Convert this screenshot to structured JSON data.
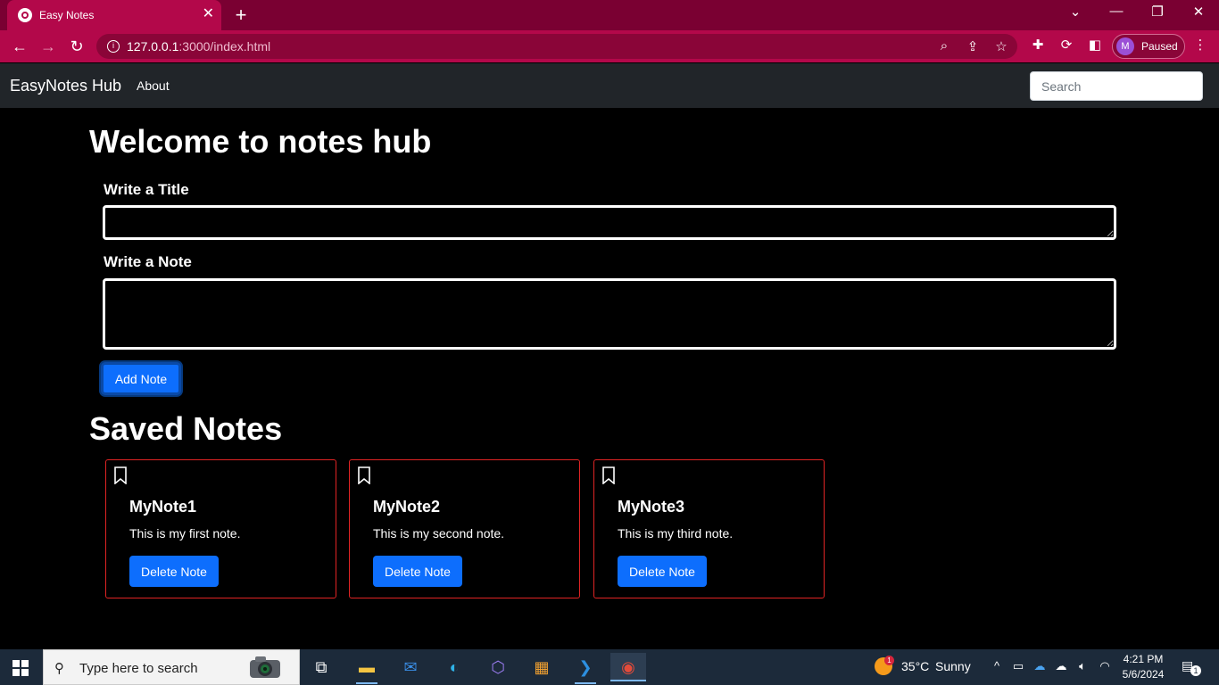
{
  "browser": {
    "tab_title": "Easy Notes",
    "tab_close": "✕",
    "new_tab": "+",
    "url_host": "127.0.0.1",
    "url_path": ":3000/index.html",
    "profile_initial": "M",
    "profile_status": "Paused",
    "window_controls": {
      "dropdown": "⌄",
      "minimize": "—",
      "restore": "❐",
      "close": "✕"
    }
  },
  "navbar": {
    "brand": "EasyNotes Hub",
    "links": [
      {
        "label": "About"
      }
    ],
    "search_placeholder": "Search"
  },
  "main": {
    "heading": "Welcome to notes hub",
    "title_label": "Write a Title",
    "note_label": "Write a Note",
    "title_value": "",
    "note_value": "",
    "add_button": "Add Note"
  },
  "saved": {
    "heading": "Saved Notes",
    "notes": [
      {
        "title": "MyNote1",
        "text": "This is my first note.",
        "delete_label": "Delete Note"
      },
      {
        "title": "MyNote2",
        "text": "This is my second note.",
        "delete_label": "Delete Note"
      },
      {
        "title": "MyNote3",
        "text": "This is my third note.",
        "delete_label": "Delete Note"
      }
    ],
    "card_border_color": "#e02424",
    "button_color": "#0d6efd"
  },
  "taskbar": {
    "search_placeholder": "Type here to search",
    "weather_badge": "1",
    "temperature": "35°C",
    "condition": "Sunny",
    "time": "4:21 PM",
    "date": "5/6/2024",
    "notification_count": "1"
  }
}
